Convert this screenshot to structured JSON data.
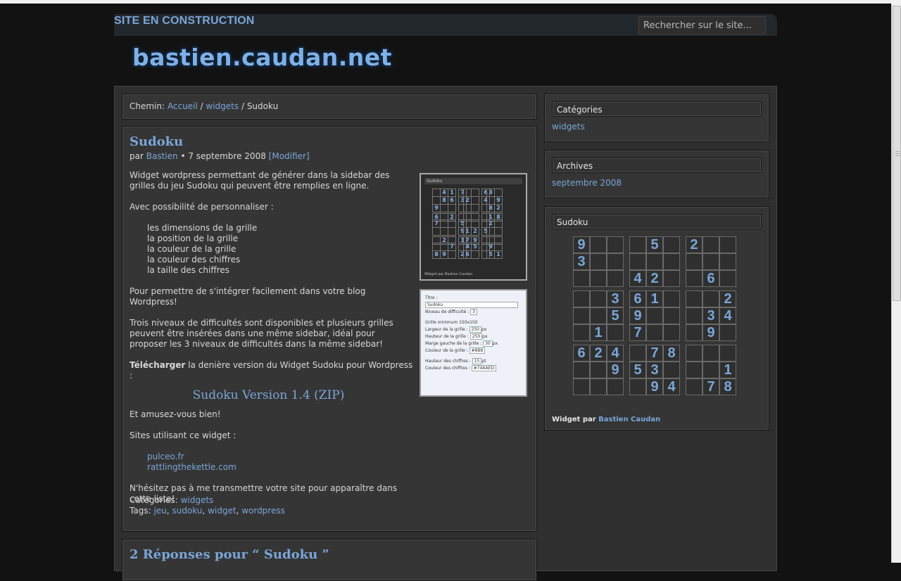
{
  "header": {
    "site_status": "SITE EN CONSTRUCTION",
    "search_placeholder": "Rechercher sur le site...",
    "logo": "bastien.caudan.net"
  },
  "breadcrumb": {
    "prefix": "Chemin:",
    "items": [
      "Accueil",
      "widgets"
    ],
    "current": "Sudoku"
  },
  "post": {
    "title": "Sudoku",
    "by": "par",
    "author": "Bastien",
    "date": "• 7 septembre 2008",
    "edit": "[Modifier]",
    "intro": "Widget wordpress permettant de générer dans la sidebar des grilles du jeu Sudoku qui peuvent être remplies en ligne.",
    "custom_heading": "Avec possibilité de personnaliser :",
    "options": [
      "les dimensions de la grille",
      "la position de la grille",
      "la couleur de la grille",
      "la couleur des chiffres",
      "la taille des chiffres"
    ],
    "integrate": "Pour permettre de s'intégrer facilement dans votre blog Wordpress!",
    "levels": "Trois niveaux de difficultés sont disponibles et plusieurs grilles peuvent être insérées dans une même sidebar, idéal pour proposer les 3 niveaux de difficultés dans la même sidebar!",
    "download_bold": "Télécharger",
    "download_rest": " la denière version du Widget Sudoku pour Wordpress :",
    "download_link": "Sudoku Version 1.4 (ZIP)",
    "enjoy": "Et amusez-vous bien!",
    "sites_heading": "Sites utilisant ce widget :",
    "sites": [
      "pulceo.fr",
      "rattlingthekettle.com"
    ],
    "share": "N'hésitez pas à me transmettre votre site pour apparaître dans cette liste!",
    "categories_label": "Catégories:",
    "categories": [
      "widgets"
    ],
    "tags_label": "Tags:",
    "tags": [
      "jeu",
      "sudoku",
      "widget",
      "wordpress"
    ]
  },
  "screenshot1": {
    "title": "Sudoku",
    "credit": "Widget par Bastien Caudan",
    "grid": [
      [
        "",
        "4",
        "1",
        "7",
        "",
        "",
        "6",
        "3",
        ""
      ],
      [
        "",
        "8",
        "6",
        "3",
        "2",
        "",
        "4",
        "",
        "9"
      ],
      [
        "9",
        "",
        "",
        "",
        "",
        "",
        "",
        "8",
        "2"
      ],
      [
        "6",
        "",
        "2",
        "",
        "",
        "",
        "",
        "1",
        "8"
      ],
      [
        "7",
        "",
        "",
        "5",
        "",
        "",
        "",
        "2",
        ""
      ],
      [
        "",
        "",
        "",
        "9",
        "1",
        "2",
        "5",
        "",
        ""
      ],
      [
        "",
        "2",
        "",
        "1",
        "7",
        "9",
        "",
        "",
        ""
      ],
      [
        "",
        "",
        "7",
        "",
        "4",
        "5",
        "",
        "9",
        ""
      ],
      [
        "8",
        "9",
        "",
        "2",
        "6",
        "",
        "",
        "5",
        "1"
      ]
    ]
  },
  "screenshot2": {
    "rows": [
      {
        "label": "Titre :",
        "value": ""
      },
      {
        "label": "",
        "value": "Sudoku"
      },
      {
        "label": "Niveau de difficulté :",
        "value": "3"
      },
      {
        "label": "Grille minimum 150x150",
        "value": ""
      },
      {
        "label": "Largeur de la grille :",
        "value": "250",
        "unit": "px"
      },
      {
        "label": "Hauteur de la grille :",
        "value": "250",
        "unit": "px"
      },
      {
        "label": "Marge gauche de la grille :",
        "value": "30",
        "unit": "px"
      },
      {
        "label": "Couleur de la grille :",
        "value": "#888"
      },
      {
        "label": "Hauteur des chiffres :",
        "value": "15",
        "unit": "pt"
      },
      {
        "label": "Couleur des chiffres :",
        "value": "#74AAED"
      }
    ]
  },
  "sidebar": {
    "categories_title": "Catégories",
    "categories": [
      "widgets"
    ],
    "archives_title": "Archives",
    "archives": [
      "septembre 2008"
    ],
    "sudoku_title": "Sudoku",
    "credit_prefix": "Widget par",
    "credit_name": "Bastien Caudan",
    "grid": [
      [
        "9",
        "",
        "",
        "",
        "5",
        "",
        "2",
        "",
        ""
      ],
      [
        "3",
        "",
        "",
        "",
        "",
        "",
        "",
        "",
        ""
      ],
      [
        "",
        "",
        "",
        "4",
        "2",
        "",
        "",
        "6",
        ""
      ],
      [
        "",
        "",
        "3",
        "6",
        "1",
        "",
        "",
        "",
        "2"
      ],
      [
        "",
        "",
        "5",
        "9",
        "",
        "",
        "",
        "3",
        "4"
      ],
      [
        "",
        "1",
        "",
        "7",
        "",
        "",
        "",
        "9",
        ""
      ],
      [
        "6",
        "2",
        "4",
        "",
        "7",
        "8",
        "",
        "",
        ""
      ],
      [
        "",
        "",
        "9",
        "5",
        "3",
        "",
        "",
        "",
        "1"
      ],
      [
        "",
        "",
        "",
        "",
        "9",
        "4",
        "",
        "7",
        "8"
      ]
    ]
  },
  "comments": {
    "title": "2 Réponses pour “ Sudoku ”"
  }
}
